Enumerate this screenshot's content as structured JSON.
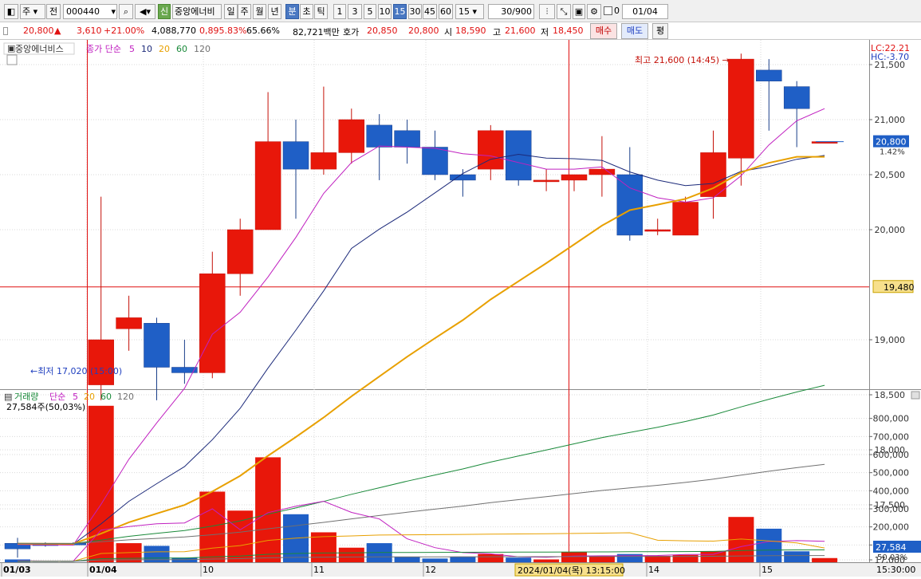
{
  "toolbar": {
    "type_select": "주",
    "type_select2": "전",
    "code": "000440",
    "badge": "신",
    "stock_name": "중앙에너비",
    "periods": [
      "일",
      "주",
      "월",
      "년",
      "분",
      "초",
      "틱"
    ],
    "active_period": "분",
    "minutes": [
      "1",
      "3",
      "5",
      "10",
      "15",
      "30",
      "45",
      "60"
    ],
    "active_minute": "15",
    "minute_value": "15",
    "count": "30",
    "count_total": "/900",
    "checkbox_value": "0",
    "date": "01/04"
  },
  "quote": {
    "price": "20,800",
    "change_arrow": "▲",
    "change": "3,610",
    "change_pct": "+21.00%",
    "volume": "4,088,770",
    "vol_ratio": "0,895.83%",
    "turnover": "65.66%",
    "amount": "82,721백만",
    "bid_label": "호가",
    "ask": "20,850",
    "bid": "20,800",
    "open_label": "시",
    "open": "18,590",
    "high_label": "고",
    "high": "21,600",
    "low_label": "저",
    "low": "18,450",
    "buy_button": "매수",
    "sell_button": "매도",
    "eval_button": "평"
  },
  "price_panel": {
    "title": "중앙에너비스",
    "ma_label": "종가 단순",
    "ma_periods": [
      "5",
      "10",
      "20",
      "60",
      "120"
    ],
    "ma_colors": [
      "#c020c0",
      "#1c2a7a",
      "#e8a000",
      "#1a8a3a",
      "#707070"
    ],
    "lc": "LC:22.21",
    "hc": "HC:-3.70",
    "high_note": "최고 21,600 (14:45)",
    "low_note": "최저 17,020 (15:00)",
    "current_price_tag": "20,800",
    "current_pct_tag": "1.42%",
    "cursor_price_tag": "19,480",
    "y_ticks": [
      "21,500",
      "21,000",
      "20,500",
      "20,000",
      "19,000",
      "18,500",
      "18,000",
      "17,500",
      "17,000"
    ],
    "y_values": [
      21500,
      21000,
      20500,
      20000,
      19000,
      18500,
      18000,
      17500,
      17000
    ],
    "cursor_price": 19480,
    "current_price": 20800
  },
  "volume_panel": {
    "title": "거래량",
    "ma_label": "단순",
    "ma_periods": [
      "5",
      "20",
      "60",
      "120"
    ],
    "ma_colors": [
      "#c020c0",
      "#e8a000",
      "#1a8a3a",
      "#707070"
    ],
    "cursor_value": "27,584주(50,03%)",
    "current_tag": "27,584",
    "pct_tag": "50.03%",
    "y_ticks": [
      "800,000",
      "700,000",
      "600,000",
      "500,000",
      "400,000",
      "300,000",
      "200,000",
      "100,000"
    ],
    "y_values": [
      800000,
      700000,
      600000,
      500000,
      400000,
      300000,
      200000,
      100000
    ]
  },
  "x_axis": {
    "labels": [
      "01/03",
      "01/04",
      "10",
      "11",
      "12",
      "14",
      "15"
    ],
    "cursor_label": "2024/01/04(목) 13:15:00",
    "right_label": "15:30:00"
  },
  "chart_data": {
    "type": "candlestick",
    "title": "중앙에너비스",
    "candles": [
      {
        "o": 17150,
        "h": 17200,
        "l": 17020,
        "c": 17100,
        "v": 20000
      },
      {
        "o": 17150,
        "h": 17160,
        "l": 17120,
        "c": 17130,
        "v": 5000
      },
      {
        "o": 17150,
        "h": 17160,
        "l": 17130,
        "c": 17140,
        "v": 5000
      },
      {
        "o": 18590,
        "h": 20300,
        "l": 18450,
        "c": 19000,
        "v": 870000
      },
      {
        "o": 19100,
        "h": 19400,
        "l": 18900,
        "c": 19200,
        "v": 110000
      },
      {
        "o": 19150,
        "h": 19200,
        "l": 18450,
        "c": 18750,
        "v": 95000
      },
      {
        "o": 18750,
        "h": 19000,
        "l": 18600,
        "c": 18700,
        "v": 30000
      },
      {
        "o": 18700,
        "h": 19800,
        "l": 18650,
        "c": 19600,
        "v": 395000
      },
      {
        "o": 19600,
        "h": 20100,
        "l": 19400,
        "c": 20000,
        "v": 290000
      },
      {
        "o": 20000,
        "h": 21250,
        "l": 20000,
        "c": 20800,
        "v": 585000
      },
      {
        "o": 20800,
        "h": 21000,
        "l": 20100,
        "c": 20550,
        "v": 270000
      },
      {
        "o": 20550,
        "h": 21300,
        "l": 20500,
        "c": 20700,
        "v": 170000
      },
      {
        "o": 20700,
        "h": 21100,
        "l": 20600,
        "c": 21000,
        "v": 85000
      },
      {
        "o": 20950,
        "h": 21050,
        "l": 20450,
        "c": 20750,
        "v": 110000
      },
      {
        "o": 20900,
        "h": 21000,
        "l": 20600,
        "c": 20750,
        "v": 35000
      },
      {
        "o": 20750,
        "h": 20900,
        "l": 20450,
        "c": 20500,
        "v": 25000
      },
      {
        "o": 20500,
        "h": 20550,
        "l": 20300,
        "c": 20450,
        "v": 35000
      },
      {
        "o": 20550,
        "h": 20950,
        "l": 20450,
        "c": 20900,
        "v": 50000
      },
      {
        "o": 20900,
        "h": 20900,
        "l": 20400,
        "c": 20450,
        "v": 30000
      },
      {
        "o": 20450,
        "h": 20550,
        "l": 20350,
        "c": 20450,
        "v": 20000
      },
      {
        "o": 20450,
        "h": 20500,
        "l": 20350,
        "c": 20500,
        "v": 60000
      },
      {
        "o": 20500,
        "h": 20850,
        "l": 20300,
        "c": 20550,
        "v": 40000
      },
      {
        "o": 20500,
        "h": 20750,
        "l": 19900,
        "c": 19950,
        "v": 50000
      },
      {
        "o": 20000,
        "h": 20100,
        "l": 19950,
        "c": 20000,
        "v": 40000
      },
      {
        "o": 19950,
        "h": 20300,
        "l": 19950,
        "c": 20250,
        "v": 45000
      },
      {
        "o": 20300,
        "h": 20900,
        "l": 20100,
        "c": 20700,
        "v": 65000
      },
      {
        "o": 20650,
        "h": 21600,
        "l": 20400,
        "c": 21550,
        "v": 255000
      },
      {
        "o": 21450,
        "h": 21550,
        "l": 20900,
        "c": 21350,
        "v": 190000
      },
      {
        "o": 21300,
        "h": 21350,
        "l": 20750,
        "c": 21100,
        "v": 65000
      },
      {
        "o": 20800,
        "h": 20800,
        "l": 20800,
        "c": 20800,
        "v": 27584
      }
    ]
  }
}
